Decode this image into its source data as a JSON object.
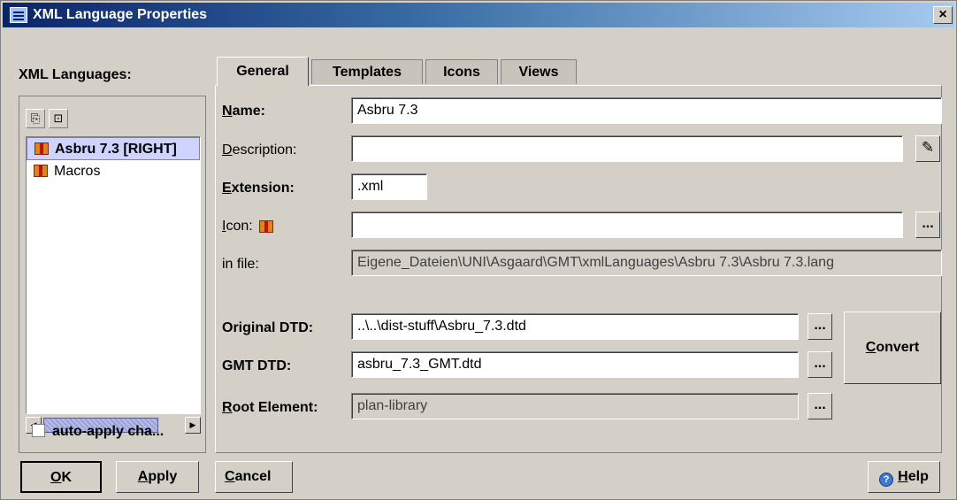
{
  "window": {
    "title": "XML Language Properties",
    "close_glyph": "×"
  },
  "left": {
    "heading": "XML Languages:",
    "toolbar": [
      {
        "icon": "new-document-icon",
        "glyph": "⎘"
      },
      {
        "icon": "delete-icon",
        "glyph": "⊡"
      }
    ],
    "languages": [
      {
        "label": "Asbru 7.3 [RIGHT]",
        "selected": true
      },
      {
        "label": "Macros",
        "selected": false
      }
    ],
    "scroll_left_glyph": "◀",
    "scroll_right_glyph": "▶",
    "auto_apply_label": "auto-apply cha..."
  },
  "tabs": [
    {
      "label": "General",
      "active": true
    },
    {
      "label": "Templates",
      "active": false
    },
    {
      "label": "Icons",
      "active": false
    },
    {
      "label": "Views",
      "active": false
    }
  ],
  "form": {
    "name": {
      "mnemonic": "N",
      "rest": "ame:",
      "value": "Asbru 7.3"
    },
    "description": {
      "mnemonic": "D",
      "rest": "escription:",
      "value": ""
    },
    "extension": {
      "mnemonic": "E",
      "rest": "xtension:",
      "value": ".xml"
    },
    "icon": {
      "mnemonic": "I",
      "rest": "con:",
      "value": ""
    },
    "in_file": {
      "label": "in file:",
      "value": "Eigene_Dateien\\UNI\\Asgaard\\GMT\\xmlLanguages\\Asbru 7.3\\Asbru 7.3.lang"
    },
    "original_dtd": {
      "label": "Original DTD:",
      "value": "..\\..\\dist-stuff\\Asbru_7.3.dtd"
    },
    "gmt_dtd": {
      "label": "GMT DTD:",
      "value": "asbru_7.3_GMT.dtd"
    },
    "root_element": {
      "mnemonic": "R",
      "rest": "oot Element:",
      "value": "plan-library"
    },
    "browse_label": "...",
    "convert": {
      "mnemonic": "C",
      "rest": "onvert"
    }
  },
  "buttons": {
    "ok": {
      "mnemonic": "O",
      "rest": "K"
    },
    "apply": {
      "mnemonic": "A",
      "rest": "pply"
    },
    "cancel": {
      "mnemonic": "C",
      "rest": "ancel"
    },
    "help": {
      "mnemonic": "H",
      "rest": "elp",
      "icon": "help-icon",
      "glyph": "?"
    }
  }
}
